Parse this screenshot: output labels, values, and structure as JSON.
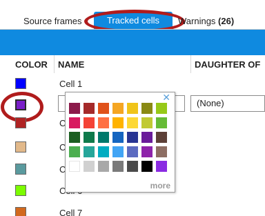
{
  "tabs": [
    {
      "label": "Source frames"
    },
    {
      "label": "Tracked cells"
    },
    {
      "label": "Warnings ",
      "count": "(26)"
    }
  ],
  "table": {
    "columns": [
      "COLOR",
      "NAME",
      "DAUGHTER OF"
    ],
    "rows": [
      {
        "color": "#0000ff",
        "name": "Cell 1"
      },
      {
        "color": "#7a1fc9",
        "name": "",
        "daughter_of": "(None)"
      },
      {
        "color": "#b02424",
        "name": "C"
      },
      {
        "color": "#e2b98a",
        "name": "C"
      },
      {
        "color": "#5a9a9e",
        "name": "C"
      },
      {
        "color": "#7cfc00",
        "name": "Cell 6"
      },
      {
        "color": "#d2691e",
        "name": "Cell 7"
      }
    ]
  },
  "picker": {
    "close_glyph": "✕",
    "more_label": "more",
    "palette": [
      [
        "#8b1a4a",
        "#a52a2a",
        "#e0521a",
        "#f5a623",
        "#f0c419",
        "#8a8a14",
        "#97c918"
      ],
      [
        "#d81b60",
        "#f44336",
        "#ff7043",
        "#ffb300",
        "#fdd835",
        "#c0ca33",
        "#66bb35"
      ],
      [
        "#1b5e20",
        "#0e7a4b",
        "#00796b",
        "#1565c0",
        "#283593",
        "#6a1b9a",
        "#5d4037"
      ],
      [
        "#4caf50",
        "#26a69a",
        "#00acc1",
        "#42a5f5",
        "#5c6bc0",
        "#8e24aa",
        "#8d6e63"
      ],
      [
        "#ffffff",
        "#d0d0d0",
        "#a8a8a8",
        "#7a7a7a",
        "#4a4a4a",
        "#000000",
        "#8a2be2"
      ]
    ]
  }
}
